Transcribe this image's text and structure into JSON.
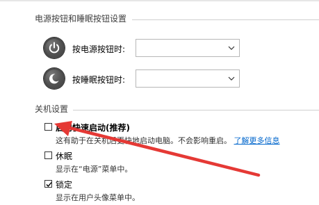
{
  "power_section": {
    "header": "电源按钮和睡眠按钮设置",
    "rows": [
      {
        "icon": "power-icon",
        "label": "按电源按钮时:",
        "value": ""
      },
      {
        "icon": "sleep-icon",
        "label": "按睡眠按钮时:",
        "value": ""
      }
    ]
  },
  "shutdown_section": {
    "header": "关机设置",
    "options": [
      {
        "label": "启用快速启动(推荐)",
        "checked": false,
        "description": "这有助于在关机后更快地启动电脑。不会影响重启。",
        "link": "了解更多信息"
      },
      {
        "label": "休眠",
        "checked": false,
        "description": "显示在“电源”菜单中。"
      },
      {
        "label": "锁定",
        "checked": true,
        "description": "显示在用户头像菜单中。"
      }
    ]
  },
  "colors": {
    "accent_link": "#0066cc",
    "annotation_arrow": "#e53935"
  }
}
